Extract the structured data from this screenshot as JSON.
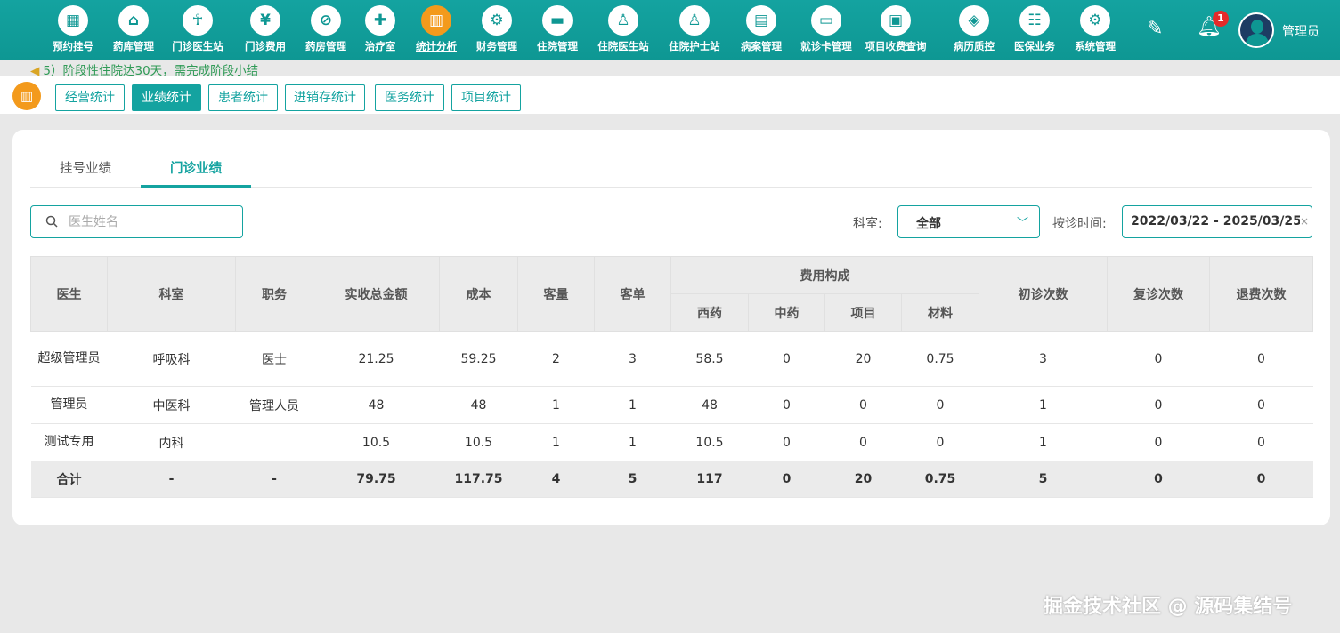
{
  "nav": {
    "items": [
      {
        "label": "预约挂号",
        "icon": "calendar-icon",
        "glyph": "▦"
      },
      {
        "label": "药库管理",
        "icon": "warehouse-icon",
        "glyph": "⌂"
      },
      {
        "label": "门诊医生站",
        "icon": "doctor-icon",
        "glyph": "☥"
      },
      {
        "label": "门诊费用",
        "icon": "yuan-icon",
        "glyph": "¥"
      },
      {
        "label": "药房管理",
        "icon": "pill-icon",
        "glyph": "⊘"
      },
      {
        "label": "治疗室",
        "icon": "nurse-icon",
        "glyph": "✚"
      },
      {
        "label": "统计分析",
        "icon": "chart-icon",
        "glyph": "▥"
      },
      {
        "label": "财务管理",
        "icon": "finance-gear-icon",
        "glyph": "⚙"
      },
      {
        "label": "住院管理",
        "icon": "bed-icon",
        "glyph": "▬"
      },
      {
        "label": "住院医生站",
        "icon": "inpatient-doctor-icon",
        "glyph": "♙"
      },
      {
        "label": "住院护士站",
        "icon": "inpatient-nurse-icon",
        "glyph": "♙"
      },
      {
        "label": "病案管理",
        "icon": "record-icon",
        "glyph": "▤"
      },
      {
        "label": "就诊卡管理",
        "icon": "card-icon",
        "glyph": "▭"
      },
      {
        "label": "项目收费查询",
        "icon": "fee-query-icon",
        "glyph": "▣"
      },
      {
        "label": "病历质控",
        "icon": "quality-icon",
        "glyph": "◈"
      },
      {
        "label": "医保业务",
        "icon": "insurance-icon",
        "glyph": "☷"
      },
      {
        "label": "系统管理",
        "icon": "settings-icon",
        "glyph": "⚙"
      }
    ],
    "active_index": 6,
    "notification_count": "1",
    "username": "管理员"
  },
  "notice": {
    "text": "5）阶段性住院达30天，需完成阶段小结"
  },
  "subtabs": {
    "items": [
      "经营统计",
      "业绩统计",
      "患者统计",
      "进销存统计",
      "医务统计",
      "项目统计"
    ],
    "active_index": 1
  },
  "tabs": {
    "items": [
      "挂号业绩",
      "门诊业绩"
    ],
    "active_index": 1
  },
  "filters": {
    "search_placeholder": "医生姓名",
    "search_value": "",
    "dept_label": "科室:",
    "dept_value": "全部",
    "date_label": "按诊时间:",
    "date_value": "2022/03/22 - 2025/03/25"
  },
  "table": {
    "headers": {
      "doctor": "医生",
      "dept": "科室",
      "title": "职务",
      "revenue": "实收总金额",
      "cost": "成本",
      "visits": "客量",
      "orders": "客单",
      "fee_group": "费用构成",
      "western": "西药",
      "chinese": "中药",
      "items": "项目",
      "material": "材料",
      "first": "初诊次数",
      "return": "复诊次数",
      "refund": "退费次数"
    },
    "rows": [
      [
        "超级管理员",
        "呼吸科",
        "医士",
        "21.25",
        "59.25",
        "2",
        "3",
        "58.5",
        "0",
        "20",
        "0.75",
        "3",
        "0",
        "0"
      ],
      [
        "管理员",
        "中医科",
        "管理人员",
        "48",
        "48",
        "1",
        "1",
        "48",
        "0",
        "0",
        "0",
        "1",
        "0",
        "0"
      ],
      [
        "测试专用",
        "内科",
        "",
        "10.5",
        "10.5",
        "1",
        "1",
        "10.5",
        "0",
        "0",
        "0",
        "1",
        "0",
        "0"
      ]
    ],
    "total": [
      "合计",
      "-",
      "-",
      "79.75",
      "117.75",
      "4",
      "5",
      "117",
      "0",
      "20",
      "0.75",
      "5",
      "0",
      "0"
    ]
  },
  "watermark": "掘金技术社区 @ 源码集结号",
  "colors": {
    "primary": "#14a3a0",
    "accent": "#f39a1c",
    "badge": "#e42a2a"
  }
}
